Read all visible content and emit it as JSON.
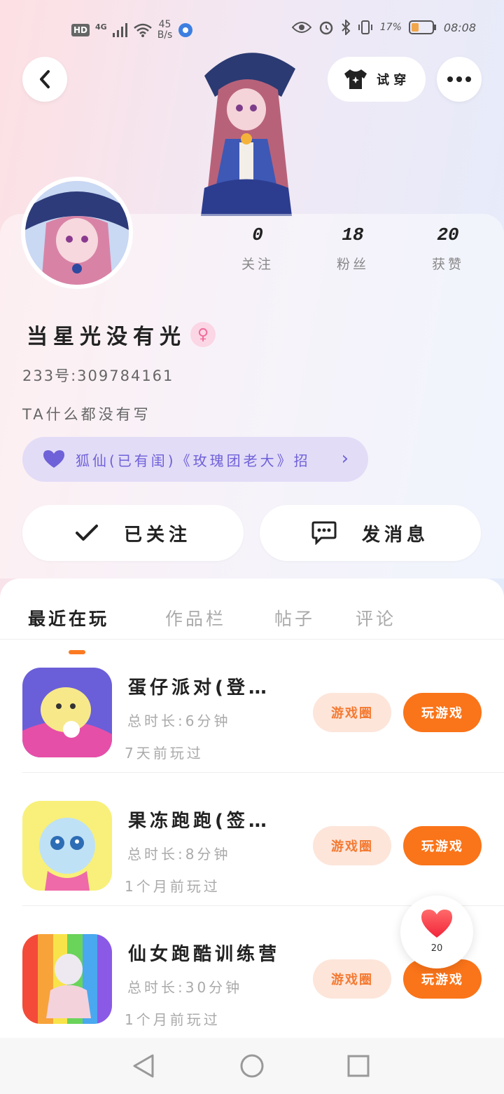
{
  "status_bar": {
    "hd": "HD",
    "network": "4G",
    "speed_value": "45",
    "speed_unit": "B/s",
    "battery_percent": "17%",
    "time": "08:08"
  },
  "header": {
    "try_on_label": "试 穿"
  },
  "profile": {
    "stats": [
      {
        "value": "0",
        "label": "关注"
      },
      {
        "value": "18",
        "label": "粉丝"
      },
      {
        "value": "20",
        "label": "获赞"
      }
    ],
    "username": "当星光没有光",
    "gender_symbol": "♀",
    "uid": "233号:309784161",
    "bio": "TA什么都没有写",
    "guild": "狐仙(已有闺)《玫瑰团老大》招"
  },
  "actions": {
    "follow_label": "已关注",
    "message_label": "发消息"
  },
  "tabs": [
    {
      "label": "最近在玩",
      "active": true
    },
    {
      "label": "作品栏",
      "active": false
    },
    {
      "label": "帖子",
      "active": false
    },
    {
      "label": "评论",
      "active": false
    }
  ],
  "games": [
    {
      "name": "蛋仔派对(登…",
      "total_time": "总时长:6分钟",
      "last_played": "7天前玩过",
      "circle_label": "游戏圈",
      "play_label": "玩游戏"
    },
    {
      "name": "果冻跑跑(签…",
      "total_time": "总时长:8分钟",
      "last_played": "1个月前玩过",
      "circle_label": "游戏圈",
      "play_label": "玩游戏"
    },
    {
      "name": "仙女跑酷训练营",
      "total_time": "总时长:30分钟",
      "last_played": "1个月前玩过",
      "circle_label": "游戏圈",
      "play_label": "玩游戏"
    }
  ],
  "like_float": {
    "count": "20"
  },
  "colors": {
    "accent_orange": "#fa7419",
    "guild_purple": "#6f61d8",
    "guild_bg": "#e2dcf7"
  }
}
